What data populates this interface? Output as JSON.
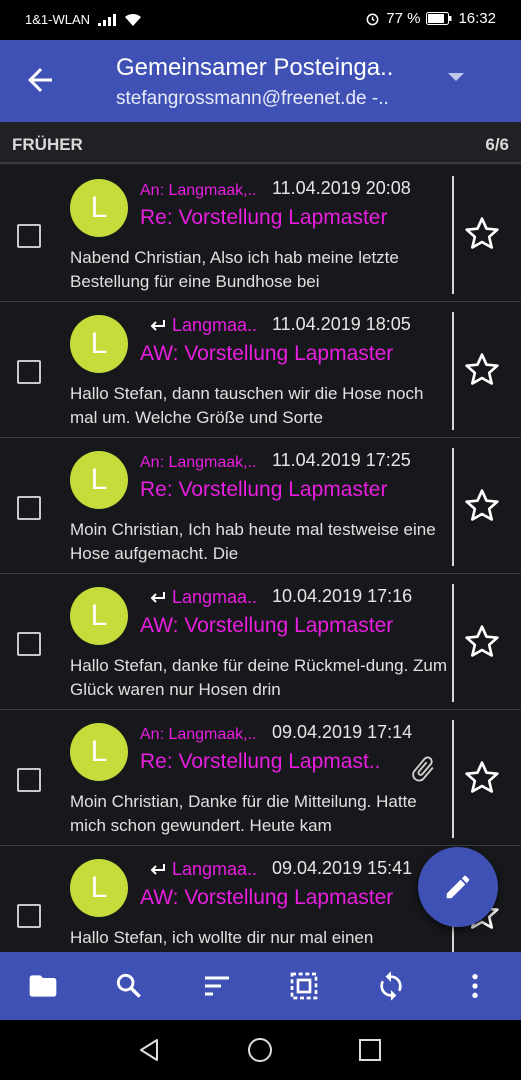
{
  "status_bar": {
    "carrier": "1&1-WLAN",
    "battery": "77 %",
    "time": "16:32"
  },
  "app_bar": {
    "title": "Gemeinsamer Posteinga..",
    "subtitle": "stefangrossmann@freenet.de -.."
  },
  "section": {
    "label": "FRÜHER",
    "count": "6/6"
  },
  "messages": [
    {
      "sender": "An: Langmaak,..",
      "type": "sent",
      "date": "11.04.2019 20:08",
      "subject": "Re: Vorstellung Lapmaster",
      "preview": "Nabend Christian, Also ich hab meine letzte Bestellung für eine Bundhose bei",
      "avatar": "L",
      "attachment": false
    },
    {
      "sender": "Langmaa..",
      "type": "reply",
      "date": "11.04.2019 18:05",
      "subject": "AW: Vorstellung Lapmaster",
      "preview": "Hallo Stefan, dann tauschen wir die Hose noch mal um. Welche Größe und Sorte",
      "avatar": "L",
      "attachment": false
    },
    {
      "sender": "An: Langmaak,..",
      "type": "sent",
      "date": "11.04.2019 17:25",
      "subject": "Re: Vorstellung Lapmaster",
      "preview": "Moin Christian, Ich hab heute mal testweise eine Hose aufgemacht. Die",
      "avatar": "L",
      "attachment": false
    },
    {
      "sender": "Langmaa..",
      "type": "reply",
      "date": "10.04.2019 17:16",
      "subject": "AW: Vorstellung Lapmaster",
      "preview": "Hallo Stefan, danke für deine Rückmel-dung. Zum Glück waren nur Hosen drin",
      "avatar": "L",
      "attachment": false
    },
    {
      "sender": "An: Langmaak,..",
      "type": "sent",
      "date": "09.04.2019 17:14",
      "subject": "Re: Vorstellung Lapmast..",
      "preview": "Moin Christian, Danke für die Mitteilung. Hatte mich schon gewundert. Heute kam",
      "avatar": "L",
      "attachment": true
    },
    {
      "sender": "Langmaa..",
      "type": "reply",
      "date": "09.04.2019 15:41",
      "subject": "AW: Vorstellung Lapmaster",
      "preview": "Hallo Stefan, ich wollte dir nur mal einen",
      "avatar": "L",
      "attachment": false
    }
  ],
  "colors": {
    "primary": "#3f51b5",
    "accent_text": "#e91ee0",
    "avatar": "#c6dc3a"
  },
  "icons": {
    "toolbar": [
      "folder-icon",
      "search-icon",
      "sort-icon",
      "select-all-icon",
      "sync-icon",
      "more-vert-icon"
    ],
    "fab": "edit-icon"
  }
}
